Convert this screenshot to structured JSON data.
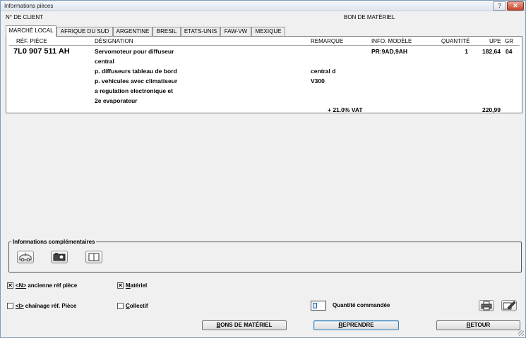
{
  "window": {
    "title": "Informations pièces",
    "help": "?",
    "close": "✕"
  },
  "header": {
    "client_label": "N° DE CLIENT",
    "bon_label": "BON DE MATÉRIEL"
  },
  "tabs": [
    {
      "label": "MARCHÉ LOCAL",
      "active": true
    },
    {
      "label": "AFRIQUE DU SUD",
      "active": false
    },
    {
      "label": "ARGENTINE",
      "active": false
    },
    {
      "label": "BRESIL",
      "active": false
    },
    {
      "label": "ETATS-UNIS",
      "active": false
    },
    {
      "label": "FAW-VW",
      "active": false
    },
    {
      "label": "MEXIQUE",
      "active": false
    }
  ],
  "table": {
    "columns": {
      "ref": "RÉF. PIÈCE",
      "designation": "DÉSIGNATION",
      "remarque": "REMARQUE",
      "info": "INFO. MODÈLE",
      "quantite": "QUANTITÉ",
      "upe": "UPE",
      "gr": "GR"
    },
    "row": {
      "ref": "7L0 907 511 AH",
      "designation_lines": [
        "Servomoteur pour diffuseur",
        "central",
        "p. diffuseurs tableau de bord",
        "p. vehicules avec climatiseur",
        "a regulation electronique et",
        "2e evaporateur"
      ],
      "remarque_lines": [
        "central d",
        "V300"
      ],
      "info": "PR:9AD,9AH",
      "quantite": "1",
      "upe": "182,64",
      "gr": "04"
    },
    "vat_label": "+ 21.0% VAT",
    "vat_total": "220,99"
  },
  "info_comp": {
    "legend": "Informations complémentaires",
    "icons": [
      "vehicle-icon",
      "camera-icon",
      "book-icon"
    ]
  },
  "options": {
    "ancienne": {
      "key": "<N>",
      "label": " ancienne réf pièce",
      "checked": true
    },
    "materiel": {
      "key": "M",
      "label": "atériel",
      "checked": true
    },
    "chainage": {
      "key": "<I>",
      "label": " chaînage réf. Pièce",
      "checked": false
    },
    "collectif": {
      "key": "C",
      "label": "ollectif",
      "checked": false
    }
  },
  "quantite_commandee": {
    "label": "Quantité commandée",
    "value": ""
  },
  "buttons": {
    "bons_key": "B",
    "bons_rest": "ONS DE MATÉRIEL",
    "reprendre_key": "R",
    "reprendre_rest": "EPRENDRE",
    "retour_key": "R",
    "retour_rest": "ETOUR"
  }
}
